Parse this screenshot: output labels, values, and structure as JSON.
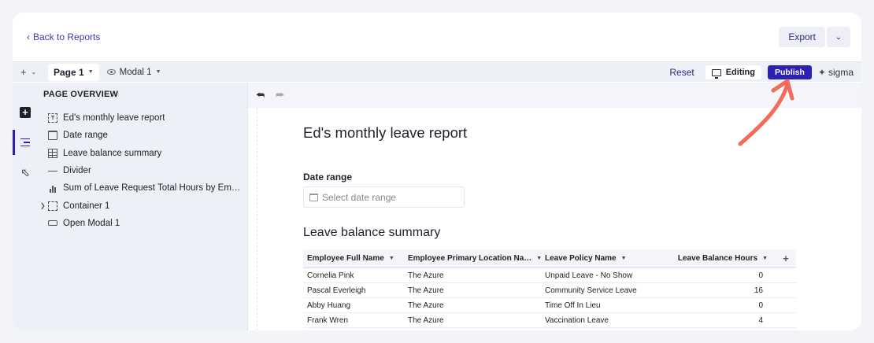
{
  "topbar": {
    "back_label": "Back to Reports",
    "export_label": "Export"
  },
  "toolbar": {
    "add_symbol": "+",
    "page_tab": "Page 1",
    "modal_tab": "Modal 1",
    "reset_label": "Reset",
    "editing_label": "Editing",
    "publish_label": "Publish",
    "brand": "sigma",
    "accent": "#2b21b5"
  },
  "panel": {
    "title": "PAGE OVERVIEW",
    "items": [
      {
        "label": "Ed's monthly leave report",
        "icon": "text-element-icon"
      },
      {
        "label": "Date range",
        "icon": "calendar-icon"
      },
      {
        "label": "Leave balance summary",
        "icon": "table-icon"
      },
      {
        "label": "Divider",
        "icon": "divider-icon"
      },
      {
        "label": "Sum of Leave Request Total Hours by Em…",
        "icon": "bar-chart-icon"
      },
      {
        "label": "Container 1",
        "icon": "container-icon"
      },
      {
        "label": "Open Modal 1",
        "icon": "button-element-icon"
      }
    ]
  },
  "canvas": {
    "report_title": "Ed's monthly leave report",
    "date_range_label": "Date range",
    "date_range_placeholder": "Select date range",
    "table_title": "Leave balance summary",
    "columns": [
      "Employee Full Name",
      "Employee Primary Location Na…",
      "Leave Policy Name",
      "Leave Balance Hours"
    ],
    "rows": [
      [
        "Cornelia Pink",
        "The Azure",
        "Unpaid Leave - No Show",
        "0"
      ],
      [
        "Pascal Everleigh",
        "The Azure",
        "Community Service Leave",
        "16"
      ],
      [
        "Abby Huang",
        "The Azure",
        "Time Off In Lieu",
        "0"
      ],
      [
        "Frank Wren",
        "The Azure",
        "Vaccination Leave",
        "4"
      ]
    ]
  },
  "annotation": {
    "arrow_color": "#f26b5b"
  }
}
